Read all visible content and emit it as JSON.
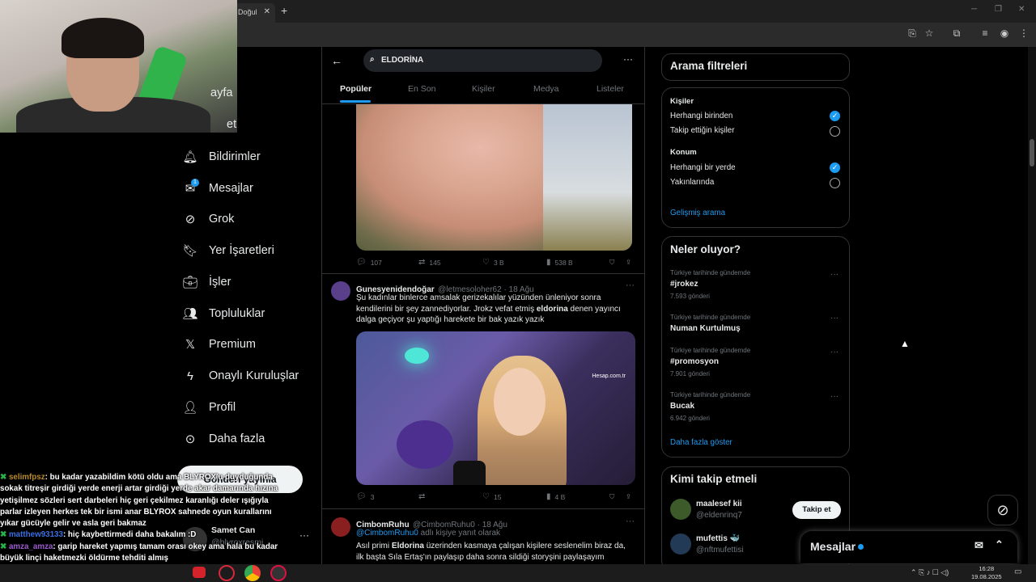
{
  "browser": {
    "tab_title": "Doğul",
    "tab_close": "✕",
    "new_tab": "+"
  },
  "nav": {
    "partial_top1": "ayfa",
    "partial_top2": "et",
    "items": [
      {
        "label": "Bildirimler",
        "icon": "bell-icon"
      },
      {
        "label": "Mesajlar",
        "icon": "envelope-icon"
      },
      {
        "label": "Grok",
        "icon": "grok-icon"
      },
      {
        "label": "Yer İşaretleri",
        "icon": "bookmark-icon"
      },
      {
        "label": "İşler",
        "icon": "briefcase-icon"
      },
      {
        "label": "Topluluklar",
        "icon": "people-icon"
      },
      {
        "label": "Premium",
        "icon": "x-logo-icon"
      },
      {
        "label": "Onaylı Kuruluşlar",
        "icon": "lightning-icon"
      },
      {
        "label": "Profil",
        "icon": "person-icon"
      },
      {
        "label": "Daha fazla",
        "icon": "more-circle-icon"
      }
    ],
    "messages_badge": "1",
    "post_button": "Gönderi yayınla",
    "account_name": "Samet Can",
    "account_handle": "@blyroxresmi",
    "account_more": "···"
  },
  "chat": [
    {
      "user": "selimfpsz",
      "text": ": bu kadar yazabildim kötü oldu ama BLYROX'u duyduğunda sokak titreşir girdiği yerde enerji artar girdiği yerde akar damarında hızına yetişilmez sözleri sert darbeleri hiç geri çekilmez karanlığı deler ışığıyla parlar izleyen herkes tek bir ismi anar BLYROX sahnede oyun kurallarını yıkar gücüyle gelir ve asla geri bakmaz"
    },
    {
      "user": "matthew93133",
      "text": ": hiç kaybettirmedi daha bakalım :D"
    },
    {
      "user": "amza_amza",
      "text": ": garip hareket yapmış tamam orası okey ama hala bu kadar büyük linçi haketmezki öldürme tehditi almış"
    }
  ],
  "search": {
    "query": "ELDORİNA",
    "more": "···",
    "tabs": [
      "Popüler",
      "En Son",
      "Kişiler",
      "Medya",
      "Listeler"
    ]
  },
  "tweets": [
    {
      "actions": {
        "replies": "107",
        "retweets": "145",
        "likes": "3 B",
        "views": "538 B"
      }
    },
    {
      "name": "Gunesyenidendoğar",
      "handle": "@letmesoloher62 · 18 Ağu",
      "text_before": "Şu kadınlar binlerce amsalak gerizekalılar yüzünden ünleniyor sonra kendilerini bir şey zannediyorlar. Jrokz vefat etmiş ",
      "text_bold": "eldorina",
      "text_after": " denen yayıncı dalga geçiyor şu yaptığı harekete bir bak yazık yazık",
      "watermark": "Hesap.com.tr",
      "actions": {
        "replies": "3",
        "retweets": "",
        "likes": "15",
        "views": "4 B"
      }
    },
    {
      "name": "CimbomRuhu",
      "handle": "@CimbomRuhu0 · 18 Ağu",
      "reply_to": "@CimbomRuhu0",
      "reply_suffix": " adlı kişiye yanıt olarak",
      "text_before": "Asıl primi ",
      "text_bold": "Eldorina",
      "text_after": " üzerinden kasmaya çalışan kişilere seslenelim biraz da, ilk başta Sıla Ertaş'ın paylaşıp daha sonra sildiği storyşini paylaşayım"
    }
  ],
  "filters": {
    "title": "Arama filtreleri",
    "people_label": "Kişiler",
    "people_options": [
      "Herhangi birinden",
      "Takip ettiğin kişiler"
    ],
    "location_label": "Konum",
    "location_options": [
      "Herhangi bir yerde",
      "Yakınlarında"
    ],
    "advanced": "Gelişmiş arama",
    "check": "✓"
  },
  "trends": {
    "title": "Neler oluyor?",
    "items": [
      {
        "meta": "Türkiye tarihinde gündemde",
        "topic": "#jrokez",
        "count": "7.593 gönderi"
      },
      {
        "meta": "Türkiye tarihinde gündemde",
        "topic": "Numan Kurtulmuş",
        "count": ""
      },
      {
        "meta": "Türkiye tarihinde gündemde",
        "topic": "#promosyon",
        "count": "7.901 gönderi"
      },
      {
        "meta": "Türkiye tarihinde gündemde",
        "topic": "Bucak",
        "count": "6.942 gönderi"
      }
    ],
    "dots": "···",
    "show_more": "Daha fazla göster"
  },
  "who_to_follow": {
    "title": "Kimi takip etmeli",
    "users": [
      {
        "name": "maalesef kii",
        "handle": "@eldenrinq7",
        "button": "Takip et"
      },
      {
        "name": "mufettis 🐳",
        "handle": "@nftmufettisi"
      }
    ]
  },
  "messages_drawer": {
    "label": "Mesajlar"
  },
  "taskbar": {
    "time": "16:28",
    "date": "19.08.2025"
  },
  "colors": {
    "accent": "#1d9bf0",
    "background": "#000000",
    "border": "#2f3336",
    "muted": "#71767b"
  }
}
